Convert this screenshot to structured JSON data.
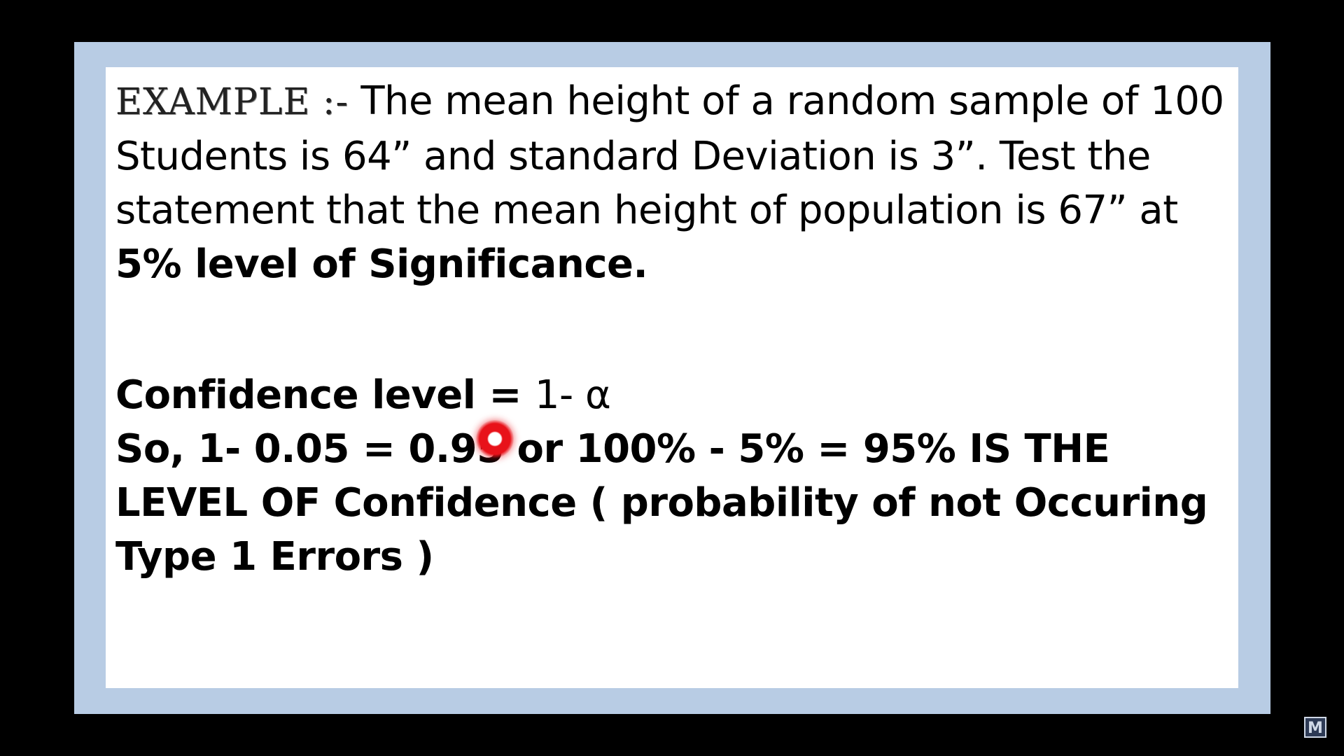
{
  "slide": {
    "example_label": "EXAMPLE :-",
    "problem_text": " The mean height of a random sample of 100 Students is 64” and standard Deviation is 3”. Test the statement that the mean height of population is 67” at ",
    "problem_bold": "5% level of Significance.",
    "confidence_label": "Confidence level = ",
    "confidence_formula": "1- α",
    "solution_text": "So, 1- 0.05 = 0.95 or 100% - 5% = 95%  IS THE LEVEL OF Confidence  ( probability of not Occuring Type 1 Errors )"
  },
  "overlay": {
    "logo_text": "M"
  },
  "colors": {
    "frame": "#b8cce4",
    "slide_bg": "#ffffff",
    "cursor": "#e8121a"
  }
}
